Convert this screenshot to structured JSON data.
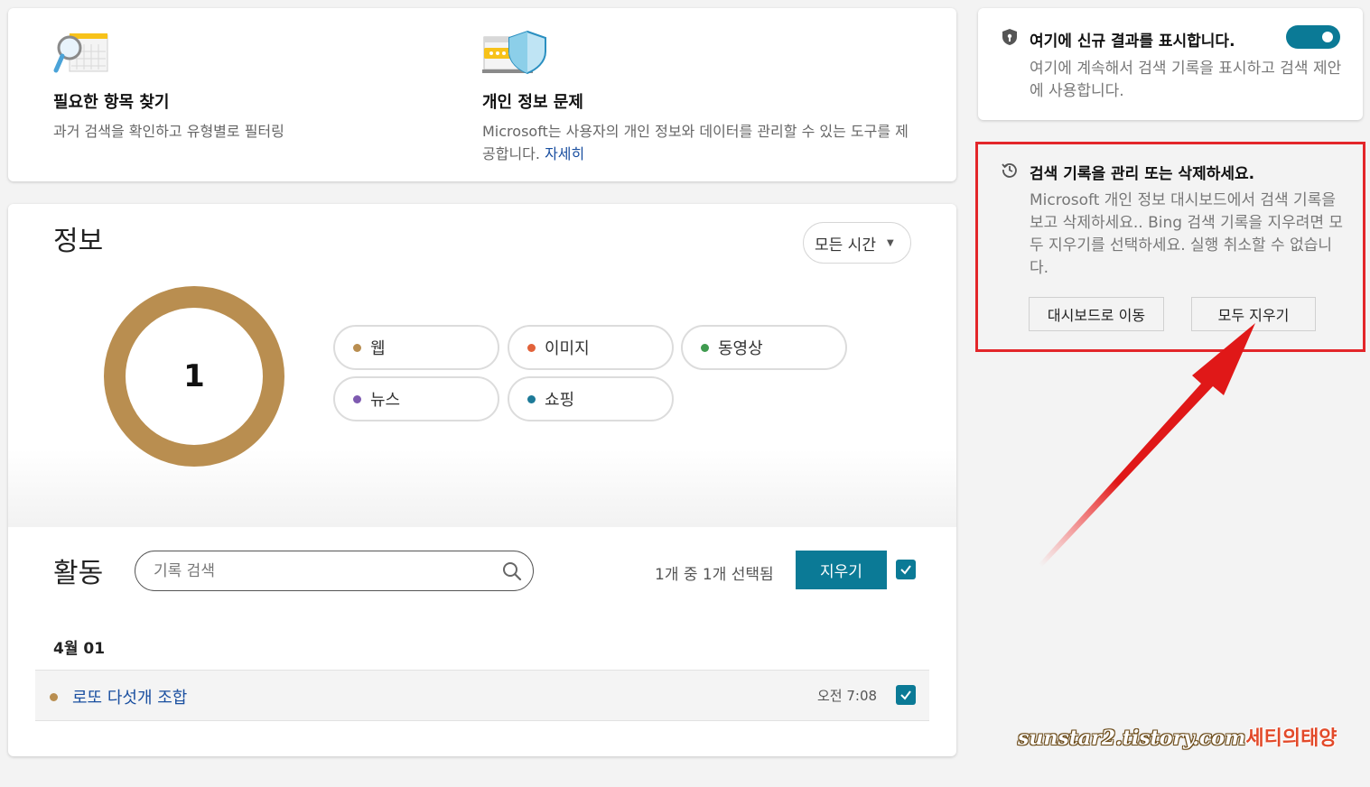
{
  "top_card": {
    "find": {
      "title": "필요한 항목 찾기",
      "desc": "과거 검색을 확인하고 유형별로 필터링"
    },
    "privacy": {
      "title": "개인 정보 문제",
      "desc": "Microsoft는 사용자의 개인 정보와 데이터를 관리할 수 있는 도구를 제공합니다.",
      "link": "자세히"
    }
  },
  "info": {
    "title": "정보",
    "time_filter": "모든 시간",
    "donut_count": "1",
    "donut_color": "#b98e50",
    "categories": [
      {
        "label": "웹",
        "color": "#b98e50"
      },
      {
        "label": "이미지",
        "color": "#e2623a"
      },
      {
        "label": "동영상",
        "color": "#3f9b4f"
      },
      {
        "label": "뉴스",
        "color": "#7e5ab0"
      },
      {
        "label": "쇼핑",
        "color": "#1d7a98"
      }
    ]
  },
  "activity": {
    "title": "활동",
    "search_placeholder": "기록 검색",
    "selection_text": "1개 중 1개 선택됨",
    "clear_button": "지우기",
    "date_label": "4월 01",
    "items": [
      {
        "text": "로또 다섯개 조합",
        "time": "오전 7:08"
      }
    ]
  },
  "right_panel": {
    "toggle_card": {
      "title": "여기에 신규 결과를 표시합니다.",
      "desc": "여기에 계속해서 검색 기록을 표시하고 검색 제안에 사용합니다.",
      "toggle_on": true
    },
    "manage_card": {
      "title": "검색 기록을 관리 또는 삭제하세요.",
      "desc": "Microsoft 개인 정보 대시보드에서 검색 기록을 보고 삭제하세요.. Bing 검색 기록을 지우려면 모두 지우기를 선택하세요. 실행 취소할 수 없습니다.",
      "dashboard_button": "대시보드로 이동",
      "clear_all_button": "모두 지우기"
    }
  },
  "accent_color": "#0b7a96",
  "watermark": {
    "url": "sunstar2.tistory.com",
    "name": "세티의태양"
  }
}
